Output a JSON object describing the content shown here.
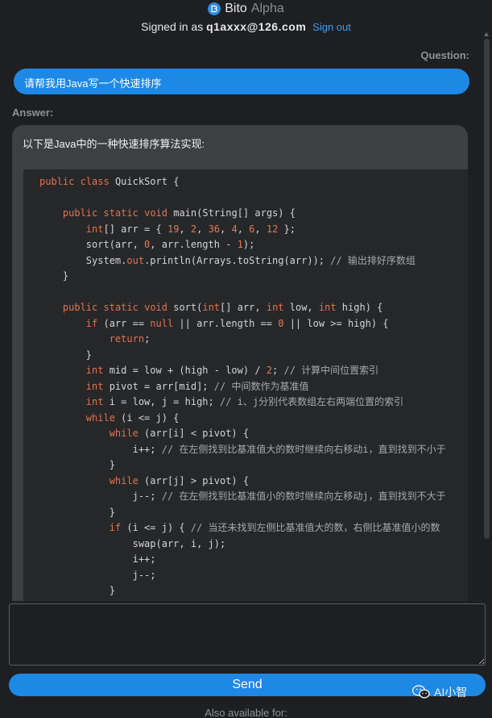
{
  "header": {
    "brand_name": "Bito",
    "brand_tag": "Alpha",
    "signed_in_prefix": "Signed in as",
    "email": "q1axxx@126.com",
    "signout_label": "Sign out"
  },
  "conversation": {
    "question_label": "Question:",
    "question_text": "请帮我用Java写一个快速排序",
    "answer_label": "Answer:",
    "answer_intro": "以下是Java中的一种快速排序算法实现:",
    "code_lines": [
      "public class QuickSort {",
      "",
      "    public static void main(String[] args) {",
      "        int[] arr = { 19, 2, 36, 4, 6, 12 };",
      "        sort(arr, 0, arr.length - 1);",
      "        System.out.println(Arrays.toString(arr)); // 输出排好序数组",
      "    }",
      "",
      "    public static void sort(int[] arr, int low, int high) {",
      "        if (arr == null || arr.length == 0 || low >= high) {",
      "            return;",
      "        }",
      "        int mid = low + (high - low) / 2; // 计算中间位置索引",
      "        int pivot = arr[mid]; // 中间数作为基准值",
      "        int i = low, j = high; // i、j分别代表数组左右两端位置的索引",
      "        while (i <= j) {",
      "            while (arr[i] < pivot) {",
      "                i++; // 在左侧找到比基准值大的数时继续向右移动i，直到找到不小于",
      "            }",
      "            while (arr[j] > pivot) {",
      "                j--; // 在左侧找到比基准值小的数时继续向左移动j，直到找到不大于",
      "            }",
      "            if (i <= j) { // 当还未找到左侧比基准值大的数，右侧比基准值小的数",
      "                swap(arr, i, j);",
      "                i++;",
      "                j--;",
      "            }"
    ]
  },
  "composer": {
    "input_value": "",
    "send_label": "Send"
  },
  "footer": {
    "also_available": "Also available for:",
    "watermark": "AI小智"
  },
  "colors": {
    "accent": "#1e88e5",
    "background": "#1e1f22",
    "answer_bg": "#3d3f43",
    "code_bg": "#262729",
    "keyword": "#e2734f",
    "link": "#3b9cf0"
  },
  "icons": [
    "bito-logo-icon",
    "wechat-icon"
  ]
}
